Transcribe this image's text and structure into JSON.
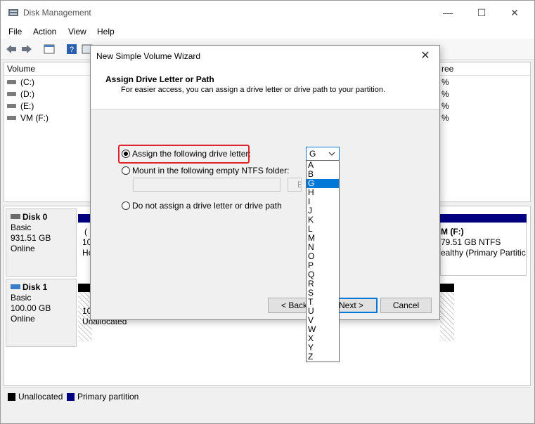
{
  "window": {
    "title": "Disk Management",
    "controls": {
      "minimize": "—",
      "maximize": "☐",
      "close": "✕"
    }
  },
  "menu": [
    "File",
    "Action",
    "View",
    "Help"
  ],
  "volume_list": {
    "columns": {
      "volume": "Volume",
      "free": "ree"
    },
    "rows": [
      {
        "name": "(C:)",
        "pct": "%"
      },
      {
        "name": "(D:)",
        "pct": "%"
      },
      {
        "name": "(E:)",
        "pct": "%"
      },
      {
        "name": "VM (F:)",
        "pct": "%"
      }
    ]
  },
  "disks": [
    {
      "name": "Disk 0",
      "type": "Basic",
      "size": "931.51 GB",
      "status": "Online",
      "partition_left": {
        "line1": "(",
        "line2": "10",
        "line3": "He"
      },
      "partition_right": {
        "line1": "M  (F:)",
        "line2": "79.51 GB NTFS",
        "line3": "ealthy (Primary Partitic"
      }
    },
    {
      "name": "Disk 1",
      "type": "Basic",
      "size": "100.00 GB",
      "status": "Online",
      "partition_left": {
        "line1": "10",
        "line2": "Unallocated"
      }
    }
  ],
  "legend": [
    {
      "label": "Unallocated",
      "color": "#000000"
    },
    {
      "label": "Primary partition",
      "color": "#000080"
    }
  ],
  "wizard": {
    "title": "New Simple Volume Wizard",
    "heading": "Assign Drive Letter or Path",
    "subheading": "For easier access, you can assign a drive letter or drive path to your partition.",
    "options": {
      "assign_letter": "Assign the following drive letter:",
      "mount_folder": "Mount in the following empty NTFS folder:",
      "no_letter": "Do not assign a drive letter or drive path"
    },
    "selected_option": "assign_letter",
    "browse_label": "Bro",
    "combo_value": "G",
    "buttons": {
      "back": "< Back",
      "next": "Next >",
      "cancel": "Cancel"
    },
    "letters": [
      "A",
      "B",
      "G",
      "H",
      "I",
      "J",
      "K",
      "L",
      "M",
      "N",
      "O",
      "P",
      "Q",
      "R",
      "S",
      "T",
      "U",
      "V",
      "W",
      "X",
      "Y",
      "Z"
    ],
    "selected_letter": "G"
  }
}
